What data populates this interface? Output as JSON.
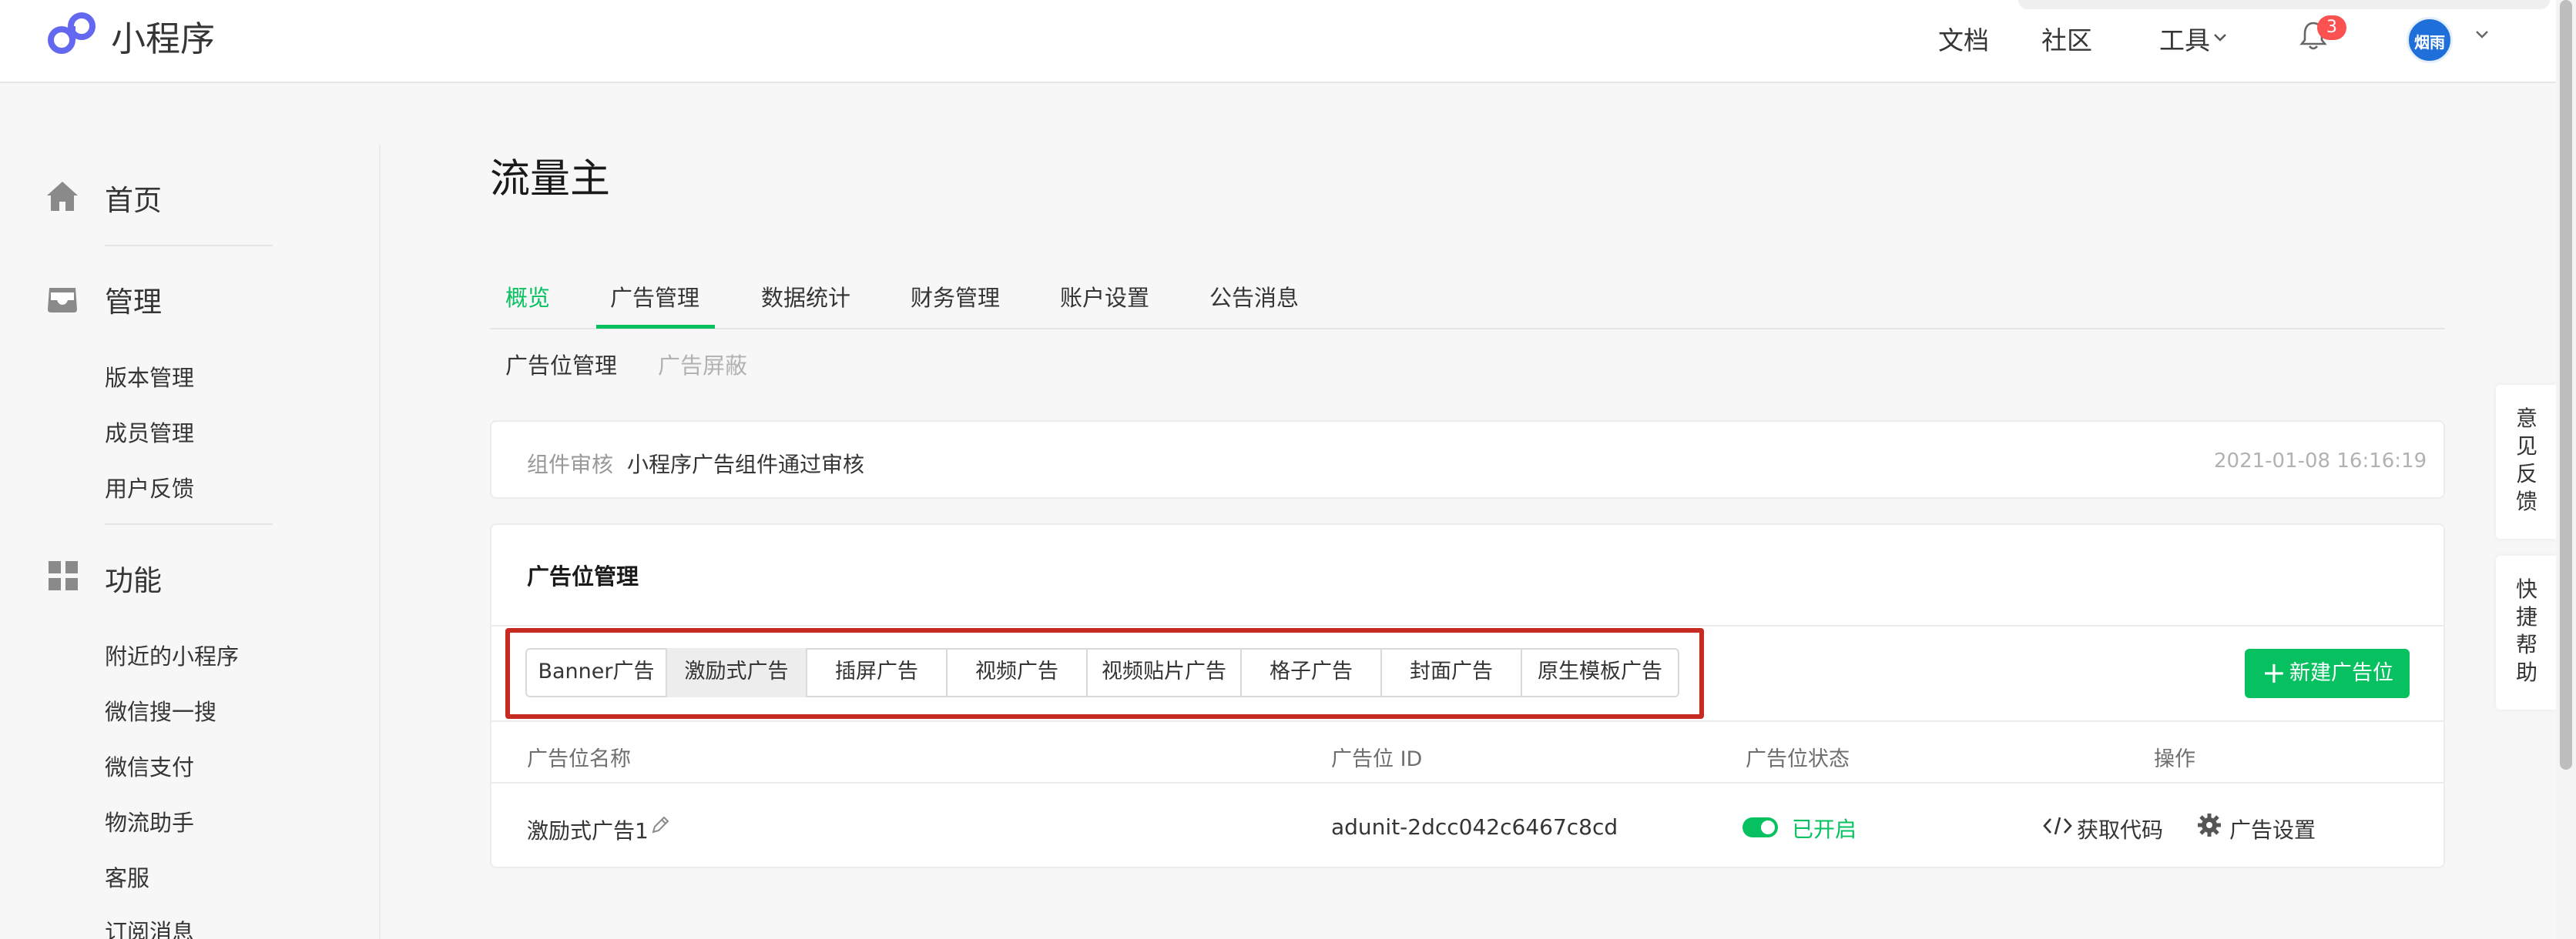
{
  "header": {
    "app_name": "小程序",
    "nav": {
      "docs": "文档",
      "community": "社区",
      "tools": "工具"
    },
    "notification_count": "3",
    "avatar_text": "烟雨"
  },
  "sidebar": {
    "home": "首页",
    "manage": "管理",
    "manage_items": [
      "版本管理",
      "成员管理",
      "用户反馈"
    ],
    "features": "功能",
    "feature_items": [
      "附近的小程序",
      "微信搜一搜",
      "微信支付",
      "物流助手",
      "客服",
      "订阅消息"
    ]
  },
  "page": {
    "title": "流量主",
    "tabs": [
      "概览",
      "广告管理",
      "数据统计",
      "财务管理",
      "账户设置",
      "公告消息"
    ],
    "subtabs": [
      "广告位管理",
      "广告屏蔽"
    ]
  },
  "notice": {
    "label": "组件审核",
    "text": "小程序广告组件通过审核",
    "time": "2021-01-08 16:16:19"
  },
  "ad_management": {
    "title": "广告位管理",
    "ad_types": [
      "Banner广告",
      "激励式广告",
      "插屏广告",
      "视频广告",
      "视频贴片广告",
      "格子广告",
      "封面广告",
      "原生模板广告"
    ],
    "new_button": "新建广告位",
    "columns": [
      "广告位名称",
      "广告位 ID",
      "广告位状态",
      "操作"
    ],
    "rows": [
      {
        "name": "激励式广告1",
        "id": "adunit-2dcc042c6467c8cd",
        "status": "已开启",
        "get_code": "获取代码",
        "settings": "广告设置"
      }
    ]
  },
  "float": {
    "feedback": "意见反馈",
    "help": "快捷帮助"
  },
  "colors": {
    "accent": "#07c160",
    "highlight": "#c62a21",
    "badge": "#fa5151"
  }
}
